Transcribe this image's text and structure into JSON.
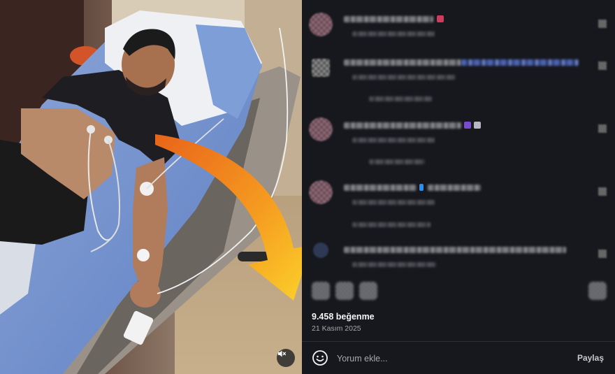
{
  "photo": {
    "alt": "man lying on hospital bed",
    "mute_icon": "speaker-muted-icon",
    "arrow_colors": [
      "#f07b1a",
      "#fcd22a"
    ]
  },
  "comments_panel": {
    "comments_blurred": true,
    "actions": {
      "icons": [
        "heart-icon",
        "comment-icon",
        "share-icon",
        "bookmark-icon"
      ]
    },
    "likes": "9.458 beğenme",
    "date": "21 Kasım 2025",
    "comment_input": {
      "placeholder": "Yorum ekle...",
      "emoji_icon": "smiley-icon"
    },
    "share_label": "Paylaş"
  },
  "colors": {
    "panel_bg": "#16181d",
    "accent_orange": "#f08a1a",
    "accent_yellow": "#fcd22a"
  }
}
